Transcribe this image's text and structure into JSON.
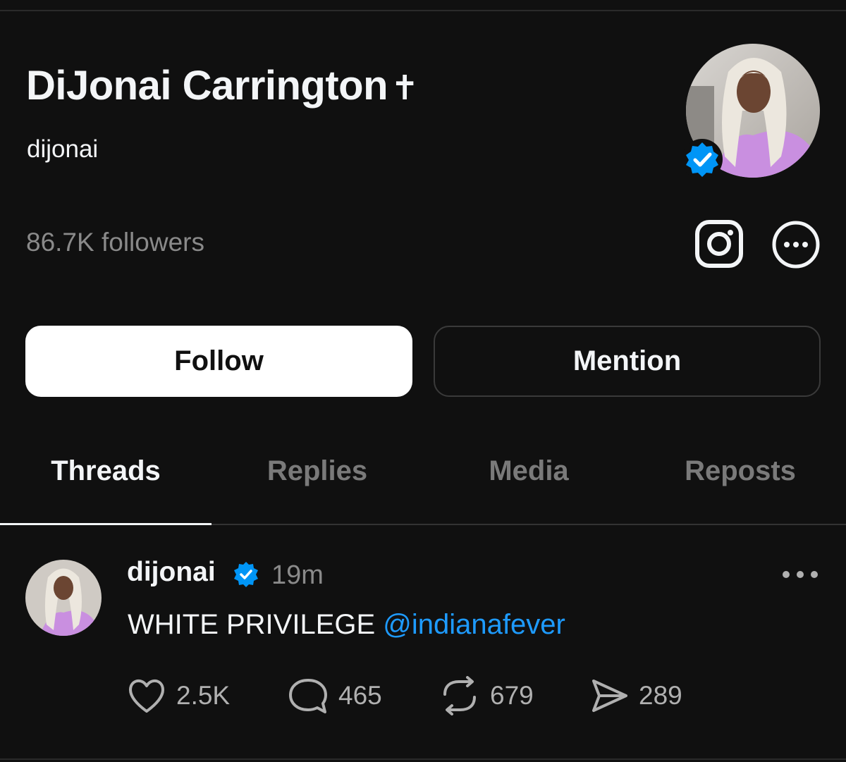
{
  "profile": {
    "display_name": "DiJonai Carrington",
    "name_emoji": "✝",
    "username": "dijonai",
    "followers_text": "86.7K followers",
    "verified": true
  },
  "actions": {
    "follow_label": "Follow",
    "mention_label": "Mention"
  },
  "tabs": [
    {
      "label": "Threads",
      "active": true
    },
    {
      "label": "Replies",
      "active": false
    },
    {
      "label": "Media",
      "active": false
    },
    {
      "label": "Reposts",
      "active": false
    }
  ],
  "post": {
    "username": "dijonai",
    "time": "19m",
    "text": "WHITE PRIVILEGE",
    "mention": "@indianafever",
    "likes": "2.5K",
    "comments": "465",
    "reposts": "679",
    "shares": "289"
  },
  "colors": {
    "background": "#101010",
    "link": "#1e9bff",
    "verified": "#0095f6"
  }
}
